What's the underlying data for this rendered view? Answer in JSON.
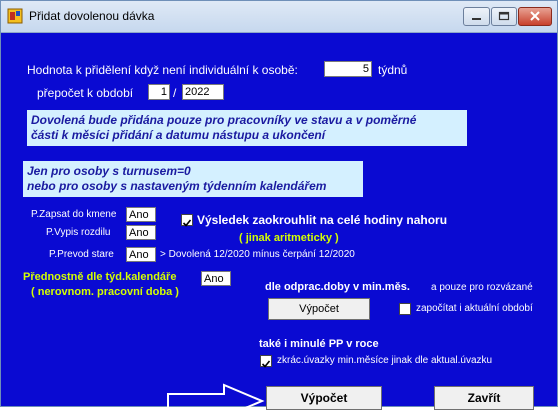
{
  "window": {
    "title": "Přidat dovolenou dávka"
  },
  "row1": {
    "label": "Hodnota k přidělení když není individuální k osobě:",
    "value": "5",
    "unit": "týdnů"
  },
  "row2": {
    "label": "přepočet k období",
    "month": "1",
    "sep": "/",
    "year": "2022"
  },
  "info1": {
    "line1": "Dovolená bude přidána pouze pro pracovníky ve stavu a v poměrné",
    "line2": "části k měsíci přidání a datumu nástupu a ukončení"
  },
  "info2": {
    "line1": "Jen pro osoby s turnusem=0",
    "line2": "nebo pro osoby s nastaveným týdenním kalendářem"
  },
  "options": {
    "zapsat_label": "P.Zapsat do kmene",
    "zapsat_value": "Ano",
    "vypis_label": "P.Vypis rozdilu",
    "vypis_value": "Ano",
    "prevod_label": "P.Prevod stare",
    "prevod_value": "Ano",
    "prevod_note": "> Dovolená 12/2020 mínus čerpání 12/2020"
  },
  "round": {
    "checked": true,
    "label": "Výsledek zaokrouhlit na celé hodiny nahoru",
    "sub": "( jinak aritmeticky )"
  },
  "calendar": {
    "line1": "Přednostně dle týd.kalendáře",
    "line2": "( nerovnom. pracovní doba )",
    "value": "Ano"
  },
  "minmes": {
    "title": "dle odprac.doby v min.měs.",
    "note": "a pouze pro rozvázané",
    "button": "Výpočet",
    "check_label": "započítat i aktuální období",
    "checked": false
  },
  "previous": {
    "title": "také i minulé PP v roce",
    "check_label": "zkrác.úvazky min.měsíce jinak dle aktual.úvazku",
    "checked": true
  },
  "footer": {
    "calc": "Výpočet",
    "close": "Zavřít"
  }
}
